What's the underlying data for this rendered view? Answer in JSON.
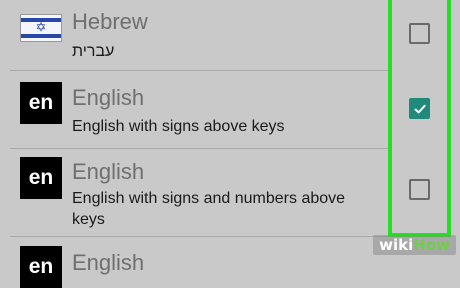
{
  "languages": [
    {
      "name": "Hebrew",
      "subtitle": "עברית",
      "icon": "israel-flag",
      "checked": false
    },
    {
      "name": "English",
      "subtitle": "English with signs above keys",
      "icon_text": "en",
      "checked": true
    },
    {
      "name": "English",
      "subtitle": "English with signs and numbers above keys",
      "icon_text": "en",
      "checked": false
    },
    {
      "name": "English",
      "icon_text": "en"
    }
  ],
  "highlight_color": "#23e023",
  "checkbox_checked_color": "#1f8a7a",
  "watermark": {
    "part1": "wiki",
    "part2": "How"
  }
}
